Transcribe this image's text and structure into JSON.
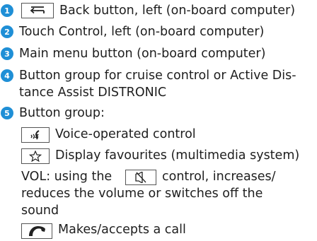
{
  "colors": {
    "badge": "#1f8fd6",
    "text": "#1e1e1e",
    "keycap_border": "#555555"
  },
  "items": [
    {
      "number": "1",
      "text": "Back button, left (on-board computer)",
      "icon": "back-arrow-icon"
    },
    {
      "number": "2",
      "text": "Touch Control, left (on-board computer)"
    },
    {
      "number": "3",
      "text": "Main menu button (on-board computer)"
    },
    {
      "number": "4",
      "text_line1": "Button group for cruise control or Active Dis-",
      "text_line2": "tance Assist DISTRONIC"
    },
    {
      "number": "5",
      "text": "Button group:"
    }
  ],
  "sub_items": {
    "voice": {
      "icon": "voice-control-icon",
      "text": "Voice-operated control"
    },
    "favourites": {
      "icon": "star-icon",
      "text": "Display favourites (multimedia system)"
    },
    "vol": {
      "prefix": "VOL: using the",
      "icon": "speaker-mute-icon",
      "suffix": "control, increases/",
      "line2": "reduces the volume or switches off the",
      "line3": "sound"
    },
    "call": {
      "icon": "phone-call-icon",
      "text": "Makes/accepts a call"
    }
  }
}
